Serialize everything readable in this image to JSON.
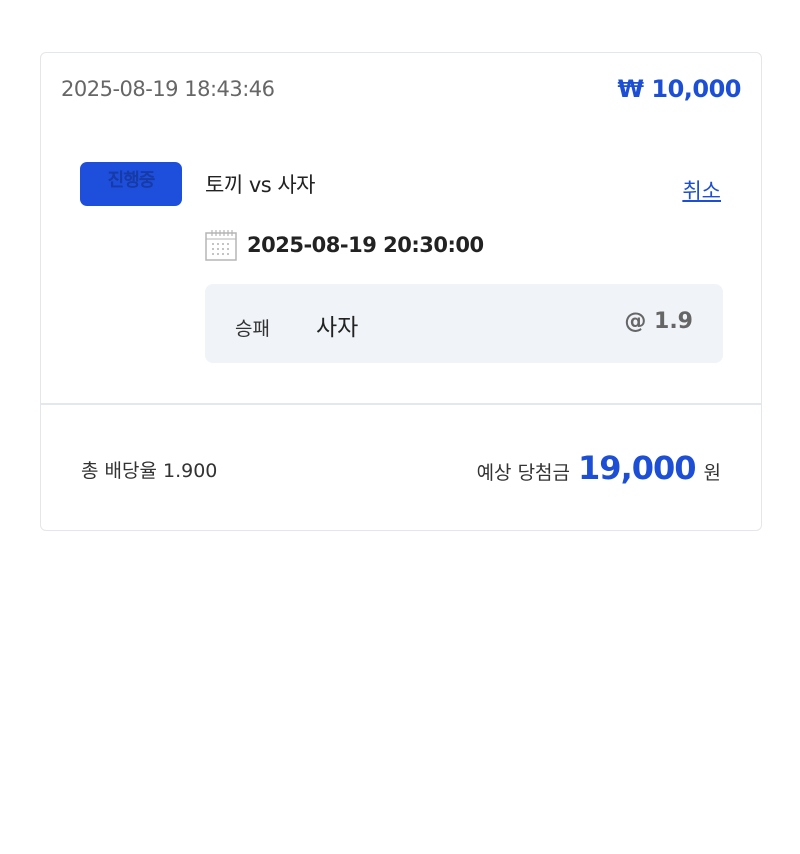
{
  "bet": {
    "placed_at": "2025-08-19 18:43:46",
    "stake": "₩ 10,000"
  },
  "match": {
    "status": "진행중",
    "title": "토끼 vs 사자",
    "cancel_label": "취소",
    "start_time": "2025-08-19 20:30:00",
    "icon": "calendar-icon"
  },
  "selection": {
    "market": "승패",
    "pick": "사자",
    "odds": "@ 1.9"
  },
  "summary": {
    "total_odds": "총 배당율 1.900",
    "payout_label": "예상 당첨금",
    "payout_amount": "19,000",
    "payout_unit": "원"
  },
  "colors": {
    "accent": "#1c4fd6",
    "badge": "#1e4fdc",
    "selection_bg": "#f0f3f7"
  }
}
